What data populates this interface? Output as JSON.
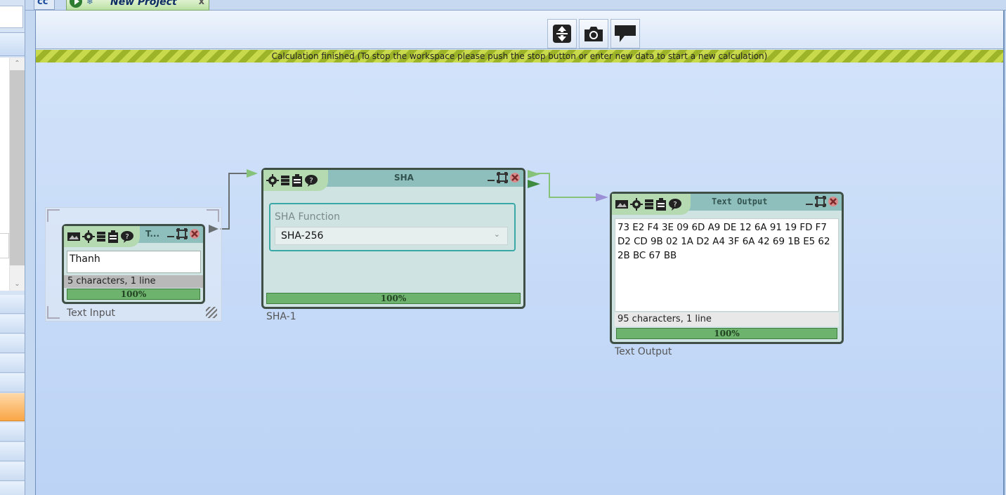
{
  "left_panel": {
    "scroll_up": "⌃",
    "scroll_down": "⌄"
  },
  "tabs": {
    "previous_tab_label": "cc",
    "active_tab_title": "New Project",
    "close_symbol": "x"
  },
  "toolbar": {
    "buttons": [
      "fit-view-icon",
      "screenshot-icon",
      "comment-icon"
    ]
  },
  "status_message": "Calculation finished (To stop the workspace please push the stop button or enter new data to start a new calculation)",
  "modules": {
    "text_input": {
      "header_title": "T...",
      "value": "Thanh",
      "stats": "5 characters,  1 line",
      "progress": "100%",
      "caption": "Text Input"
    },
    "sha": {
      "header_title": "SHA",
      "field_label": "SHA Function",
      "selected_function": "SHA-256",
      "progress": "100%",
      "caption": "SHA-1"
    },
    "text_output": {
      "header_title": "Text Output",
      "value": "73 E2 F4 3E 09 6D A9 DE 12 6A 91 19 FD F7 D2 CD 9B 02 1A D2 A4 3F 6A 42 69 1B E5 62 2B BC 67 BB",
      "stats": "95 characters,  1 line",
      "progress": "100%",
      "caption": "Text Output"
    }
  },
  "colors": {
    "module_border": "#3f4f45",
    "progress_fill": "#6db26d",
    "connector_green": "#86c27a",
    "status_stripe": "#c9d94c"
  }
}
